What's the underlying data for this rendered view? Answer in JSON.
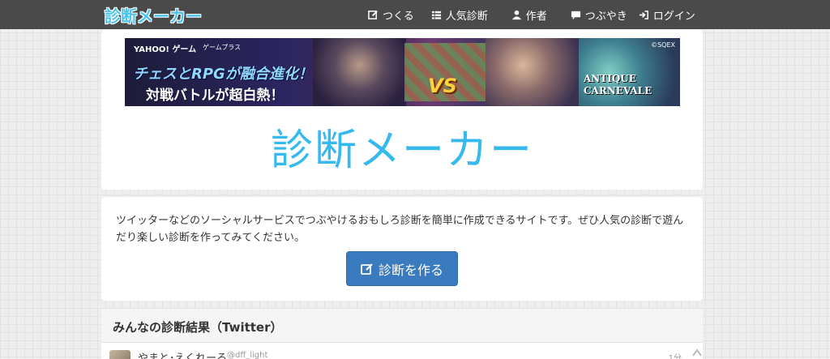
{
  "navbar": {
    "brand": "診断メーカー",
    "items": [
      {
        "label": "つくる",
        "icon": "edit-icon"
      },
      {
        "label": "人気診断",
        "icon": "list-icon"
      },
      {
        "label": "作者",
        "icon": "user-icon"
      },
      {
        "label": "つぶやき",
        "icon": "comment-icon"
      },
      {
        "label": "ログイン",
        "icon": "login-icon"
      }
    ]
  },
  "banner": {
    "logo": "YAHOO! ゲーム",
    "logo_sub": "ゲームプラス",
    "headline1": "チェスとRPGが融合進化！",
    "headline2": "対戦バトルが超白熱！",
    "vs": "VS",
    "game_title_line1": "ANTIQUE",
    "game_title_line2": "CARNEVALE",
    "copyright": "©SQEX"
  },
  "hero": {
    "title": "診断メーカー"
  },
  "description": {
    "text": "ツイッターなどのソーシャルサービスでつぶやけるおもしろ診断を簡単に作成できるサイトです。ぜひ人気の診断で遊んだり楽しい診断を作ってみてください。",
    "button_label": "診断を作る"
  },
  "results": {
    "title": "みんなの診断結果（Twitter）",
    "rows": [
      {
        "name": "やまと･えくれーる",
        "handle": "@dff_light",
        "time": "1分"
      }
    ]
  },
  "colors": {
    "navbar_bg": "#4a4a4a",
    "brand": "#4ec3ec",
    "hero": "#35b9ee",
    "button": "#3a7bbf"
  }
}
